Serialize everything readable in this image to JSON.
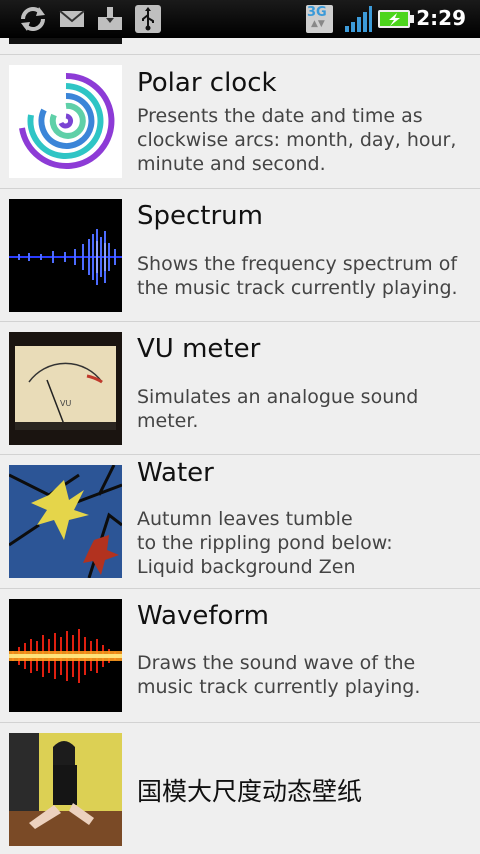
{
  "status_bar": {
    "time": "2:29",
    "network": "3G",
    "icons": [
      "sync-icon",
      "gmail-icon",
      "download-icon",
      "usb-icon",
      "3g-icon",
      "signal-icon",
      "battery-charging-icon"
    ]
  },
  "wallpapers": [
    {
      "title": "Polar clock",
      "description": "Presents the date and time as clockwise arcs: month, day, hour, minute and second."
    },
    {
      "title": "Spectrum",
      "description": "Shows the frequency spectrum of the music track currently playing."
    },
    {
      "title": "VU meter",
      "description": "Simulates an analogue sound meter."
    },
    {
      "title": "Water",
      "description_lines": [
        "Autumn leaves tumble",
        "to the rippling pond below:",
        "Liquid background Zen"
      ]
    },
    {
      "title": "Waveform",
      "description": "Draws the sound wave of the music track currently playing."
    },
    {
      "title": "国模大尺度动态壁纸"
    }
  ],
  "colors": {
    "background": "#efefef",
    "status_bar": "#000000",
    "divider": "#d2d2d2",
    "battery_green": "#4cd51c"
  }
}
